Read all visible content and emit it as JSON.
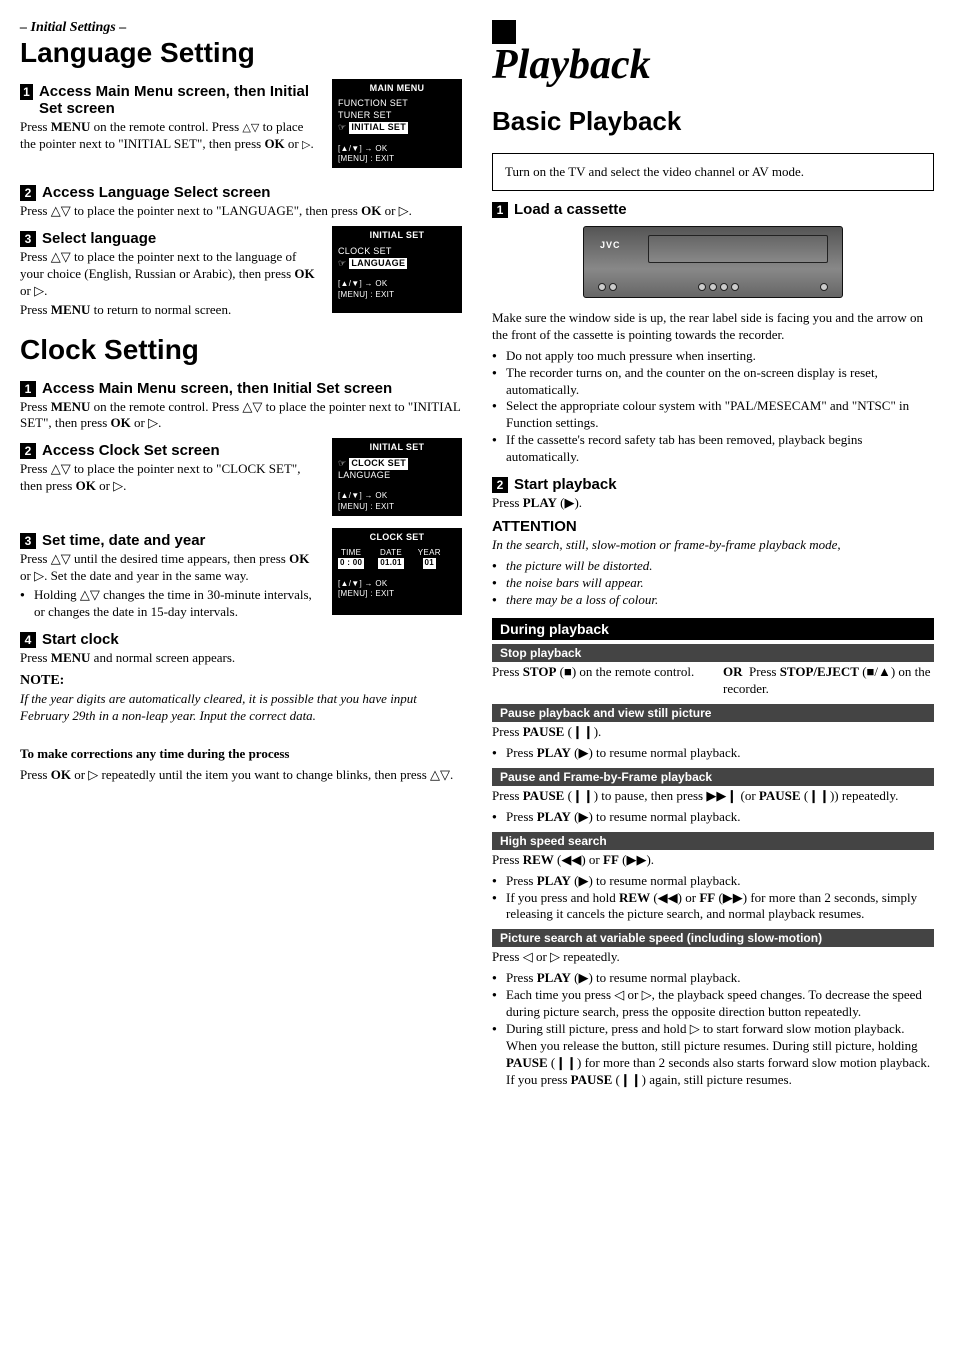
{
  "left": {
    "breadcrumb": "– Initial Settings –",
    "h1_lang": "Language Setting",
    "step1": {
      "title": "Access Main Menu screen, then Initial Set screen",
      "p1a": "Press ",
      "p1b": "MENU",
      "p1c": " on the remote control. Press ",
      "p1d": " to place the pointer next to \"INITIAL SET\", then press ",
      "p1e": "OK",
      "p1f": " or ",
      "p1end": "."
    },
    "screen1": {
      "title": "MAIN MENU",
      "r1": "FUNCTION SET",
      "r2": "TUNER SET",
      "r3": "INITIAL SET",
      "foot1": "[▲/▼] → OK",
      "foot2": "[MENU] : EXIT"
    },
    "step2": {
      "title": "Access Language Select screen",
      "p1": "Press △▽ to place the pointer next to \"LANGUAGE\", then press ",
      "p2": "OK",
      "p3": " or ▷."
    },
    "step3": {
      "title": "Select language",
      "pa": "Press △▽ to place the pointer next to the language of your choice (English, Russian or Arabic), then press ",
      "pb": "OK",
      "pc": " or ▷.",
      "pd": "Press ",
      "pe": "MENU",
      "pf": " to return to normal screen."
    },
    "screen2": {
      "title": "INITIAL SET",
      "r1": "CLOCK SET",
      "r2": "LANGUAGE",
      "foot1": "[▲/▼] → OK",
      "foot2": "[MENU] : EXIT"
    },
    "h1_clock": "Clock Setting",
    "c1": {
      "title": "Access Main Menu screen, then Initial Set screen",
      "pa": "Press ",
      "pb": "MENU",
      "pc": " on the remote control. Press △▽ to place the pointer next to \"INITIAL SET\", then press ",
      "pd": "OK",
      "pe": " or ▷."
    },
    "c2": {
      "title": "Access Clock Set screen",
      "pa": "Press △▽ to place the pointer next to \"CLOCK SET\", then press ",
      "pb": "OK",
      "pc": " or ▷."
    },
    "screen3": {
      "title": "INITIAL SET",
      "r1": "CLOCK SET",
      "r2": "LANGUAGE",
      "foot1": "[▲/▼] → OK",
      "foot2": "[MENU] : EXIT"
    },
    "c3": {
      "title": "Set time, date and year",
      "pa": "Press △▽ until the desired time appears, then press ",
      "pb": "OK",
      "pc": " or ▷. Set the date and year in the same way.",
      "b1": "Holding △▽ changes the time in 30-minute intervals, or changes the date in 15-day intervals."
    },
    "screen4": {
      "title": "CLOCK SET",
      "h_time": "TIME",
      "h_date": "DATE",
      "h_year": "YEAR",
      "v_time": "0 : 00",
      "v_date": "01.01",
      "v_year": "01",
      "foot1": "[▲/▼] → OK",
      "foot2": "[MENU] : EXIT"
    },
    "c4": {
      "title": "Start clock",
      "pa": "Press ",
      "pb": "MENU",
      "pc": " and normal screen appears."
    },
    "note_h": "NOTE:",
    "note_p": "If the year digits are automatically cleared, it is possible that you have input February 29th in a non-leap year. Input the correct data.",
    "corr_h": "To make corrections any time during the process",
    "corr_pa": "Press ",
    "corr_pb": "OK",
    "corr_pc": " or ▷ repeatedly until the item you want to change blinks, then press △▽."
  },
  "right": {
    "h1": "Playback",
    "h2": "Basic Playback",
    "box": "Turn on the TV and select the video channel or AV mode.",
    "s1_title": "Load a cassette",
    "vcr_logo": "JVC",
    "s1_p": "Make sure the window side is up, the rear label side is facing you and the arrow on the front of the cassette is pointing towards the recorder.",
    "s1_b1": "Do not apply too much pressure when inserting.",
    "s1_b2": "The recorder turns on, and the counter on the on-screen display is reset, automatically.",
    "s1_b3": "Select the appropriate colour system with \"PAL/MESECAM\" and \"NTSC\" in Function settings.",
    "s1_b4": "If the cassette's record safety tab has been removed, playback begins automatically.",
    "s2_title": "Start playback",
    "s2_pa": "Press ",
    "s2_pb": "PLAY",
    "s2_pc": " (▶).",
    "att_h": "ATTENTION",
    "att_lead": "In the search, still, slow-motion or frame-by-frame playback mode,",
    "att_b1": "the picture will be distorted.",
    "att_b2": "the noise bars will appear.",
    "att_b3": "there may be a loss of colour.",
    "bar": "During playback",
    "sb1": "Stop playback",
    "sb1_a": "Press ",
    "sb1_b": "STOP",
    "sb1_c": " (■) on the remote control.",
    "sb1_or": "OR",
    "sb1_d": "Press ",
    "sb1_e": "STOP/EJECT",
    "sb1_f": " (■/▲) on the recorder.",
    "sb2": "Pause playback and view still picture",
    "sb2_a": "Press ",
    "sb2_b": "PAUSE",
    "sb2_c": " (❙❙).",
    "sb2_bul": "Press PLAY (▶) to resume normal playback.",
    "sb3": "Pause and Frame-by-Frame playback",
    "sb3_a": "Press ",
    "sb3_b": "PAUSE",
    "sb3_c": " (❙❙) to pause, then press ▶▶❙ (or ",
    "sb3_d": "PAUSE",
    "sb3_e": " (❙❙)) repeatedly.",
    "sb3_bul": "Press PLAY (▶) to resume normal playback.",
    "sb4": "High speed search",
    "sb4_a": "Press ",
    "sb4_b": "REW",
    "sb4_c": " (◀◀) or ",
    "sb4_d": "FF",
    "sb4_e": " (▶▶).",
    "sb4_bul1": "Press PLAY (▶) to resume normal playback.",
    "sb4_bul2": "If you press and hold REW (◀◀) or FF (▶▶) for more than 2 seconds, simply releasing it cancels the picture search, and normal playback resumes.",
    "sb5": "Picture search at variable speed (including slow-motion)",
    "sb5_a": "Press ◁ or ▷ repeatedly.",
    "sb5_bul1": "Press PLAY (▶) to resume normal playback.",
    "sb5_bul2": "Each time you press ◁ or ▷, the playback speed changes. To decrease the speed during picture search, press the opposite direction button repeatedly.",
    "sb5_bul3": "During still picture, press and hold ▷ to start forward slow motion playback. When you release the button, still picture resumes. During still picture, holding PAUSE (❙❙) for more than 2 seconds also starts forward slow motion playback. If you press PAUSE (❙❙) again, still picture resumes."
  }
}
